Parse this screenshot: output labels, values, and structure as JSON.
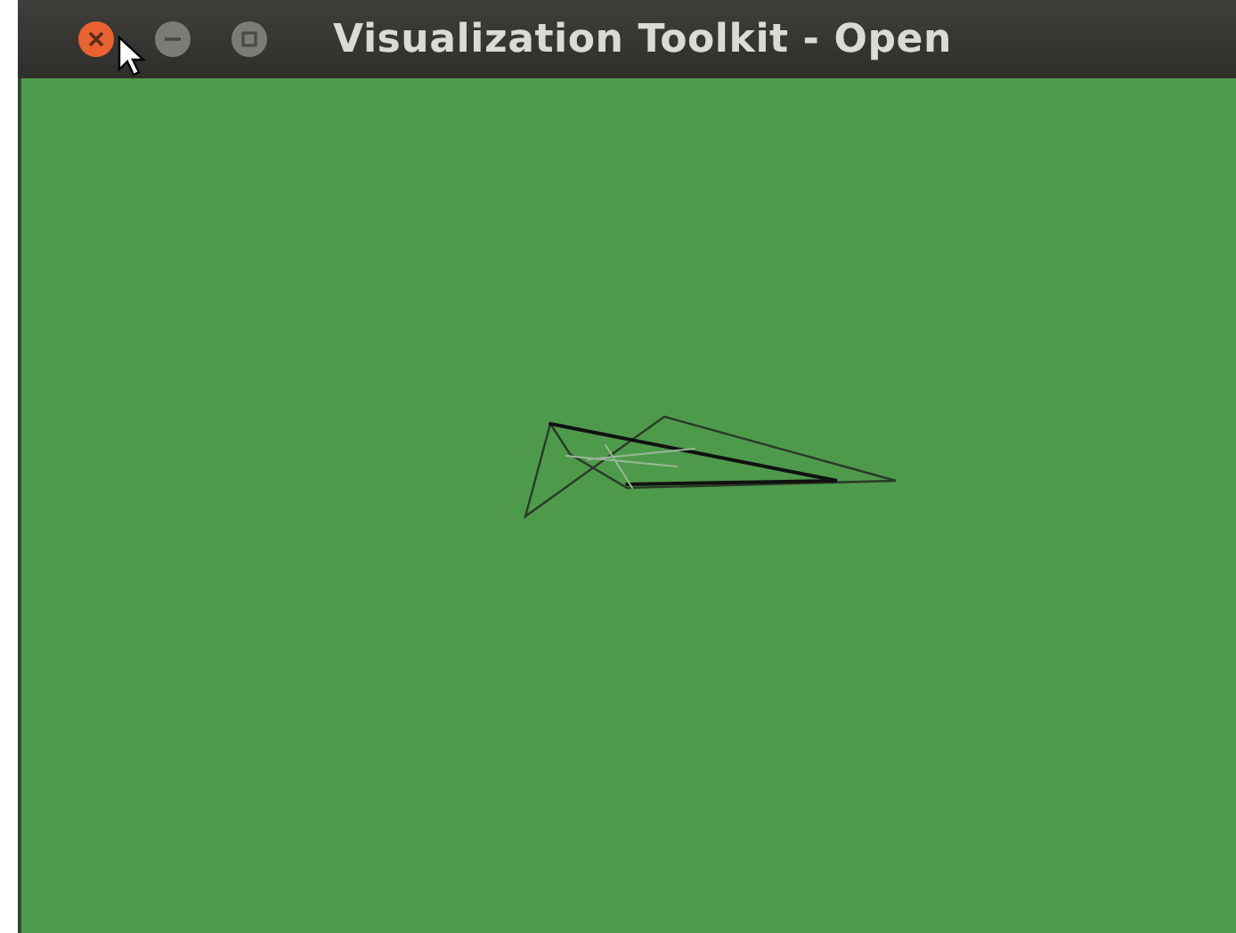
{
  "window": {
    "title": "Visualization Toolkit - Open"
  }
}
